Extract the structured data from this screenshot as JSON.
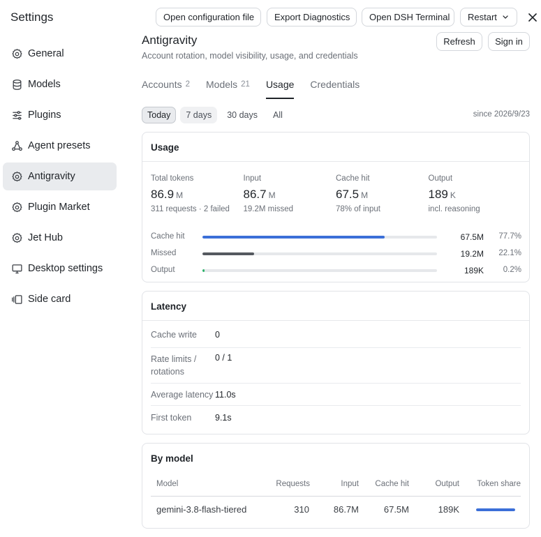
{
  "sidebar": {
    "title": "Settings",
    "items": [
      {
        "label": "General",
        "icon": "gear-icon"
      },
      {
        "label": "Models",
        "icon": "database-icon"
      },
      {
        "label": "Plugins",
        "icon": "sliders-icon"
      },
      {
        "label": "Agent presets",
        "icon": "presets-icon"
      },
      {
        "label": "Antigravity",
        "icon": "gear-icon",
        "active": true
      },
      {
        "label": "Plugin Market",
        "icon": "gear-icon"
      },
      {
        "label": "Jet Hub",
        "icon": "gear-icon"
      },
      {
        "label": "Desktop settings",
        "icon": "monitor-icon"
      },
      {
        "label": "Side card",
        "icon": "side-card-icon"
      }
    ]
  },
  "toolbar": {
    "open_config_label": "Open configuration file",
    "export_diagnostics_label": "Export Diagnostics",
    "open_terminal_label": "Open DSH Terminal",
    "restart_label": "Restart"
  },
  "header": {
    "title": "Antigravity",
    "subtitle": "Account rotation, model visibility, usage, and credentials",
    "refresh_label": "Refresh",
    "sign_in_label": "Sign in"
  },
  "tabs": [
    {
      "label": "Accounts",
      "count": "2"
    },
    {
      "label": "Models",
      "count": "21"
    },
    {
      "label": "Usage",
      "count": "",
      "active": true
    },
    {
      "label": "Credentials",
      "count": ""
    }
  ],
  "range": {
    "options": [
      "Today",
      "7 days",
      "30 days",
      "All"
    ],
    "selected": "Today",
    "since": "since 2026/9/23"
  },
  "usage": {
    "title": "Usage",
    "stats": [
      {
        "label": "Total tokens",
        "value": "86.9",
        "unit": "M",
        "sub": "311 requests · 2 failed"
      },
      {
        "label": "Input",
        "value": "86.7",
        "unit": "M",
        "sub": "19.2M missed"
      },
      {
        "label": "Cache hit",
        "value": "67.5",
        "unit": "M",
        "sub": "78% of input"
      },
      {
        "label": "Output",
        "value": "189",
        "unit": "K",
        "sub": "incl. reasoning"
      }
    ],
    "bars": [
      {
        "label": "Cache hit",
        "value": "67.5M",
        "pct": "77.7%",
        "fraction": 0.777,
        "color": "#3b6fd8"
      },
      {
        "label": "Missed",
        "value": "19.2M",
        "pct": "22.1%",
        "fraction": 0.221,
        "color": "#55595f"
      },
      {
        "label": "Output",
        "value": "189K",
        "pct": "0.2%",
        "fraction": 0.008,
        "color": "#2fb36b"
      }
    ]
  },
  "latency": {
    "title": "Latency",
    "rows": [
      {
        "label": "Cache write",
        "value": "0"
      },
      {
        "label": "Rate limits / rotations",
        "value": "0 / 1"
      },
      {
        "label": "Average latency",
        "value": "11.0s"
      },
      {
        "label": "First token",
        "value": "9.1s"
      }
    ]
  },
  "by_model": {
    "title": "By model",
    "columns": [
      "Model",
      "Requests",
      "Input",
      "Cache hit",
      "Output",
      "Token share"
    ],
    "rows": [
      {
        "model": "gemini-3.8-flash-tiered",
        "requests": "310",
        "input": "86.7M",
        "cache_hit": "67.5M",
        "output": "189K",
        "share": 1.0
      }
    ]
  }
}
